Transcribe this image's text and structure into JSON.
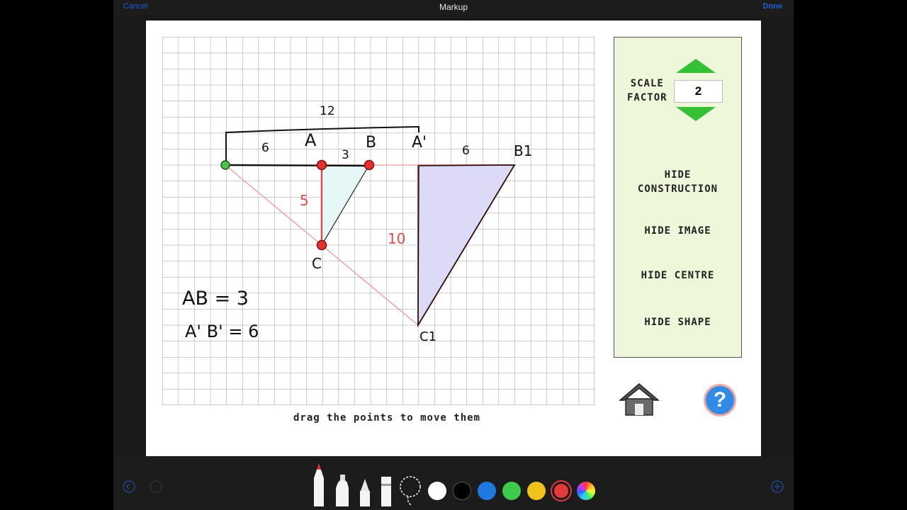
{
  "topbar": {
    "cancel": "Cancel",
    "title": "Markup",
    "done": "Done"
  },
  "panel": {
    "scale_label_1": "SCALE",
    "scale_label_2": "FACTOR",
    "scale_value": "2",
    "buttons": [
      "HIDE",
      "CONSTRUCTION",
      "HIDE IMAGE",
      "HIDE CENTRE",
      "HIDE SHAPE"
    ]
  },
  "help_label": "?",
  "caption": "drag the points to move them",
  "annotations": {
    "top_length": "12",
    "seg_oa": "6",
    "label_a": "A",
    "seg_ab": "3",
    "label_b": "B",
    "label_a1": "A'",
    "seg_a1b1": "6",
    "label_b1": "B1",
    "label_c": "C",
    "label_c1": "C1",
    "len_ac": "5",
    "len_a1c1": "10",
    "eq1": "AB = 3",
    "eq2": "A' B' = 6"
  },
  "colors": {
    "accent_green": "#35c135",
    "point_red": "#e53030",
    "help_blue": "#2f8be6",
    "panel_bg": "#eef7d9"
  },
  "toolbar": {
    "tools": [
      "pen-icon",
      "marker-icon",
      "pencil-icon",
      "eraser-icon",
      "lasso-icon"
    ],
    "swatches": [
      "#ffffff",
      "#000000",
      "#1f7ae0",
      "#3ecb4b",
      "#f2c21c",
      "#e43a3a"
    ]
  }
}
